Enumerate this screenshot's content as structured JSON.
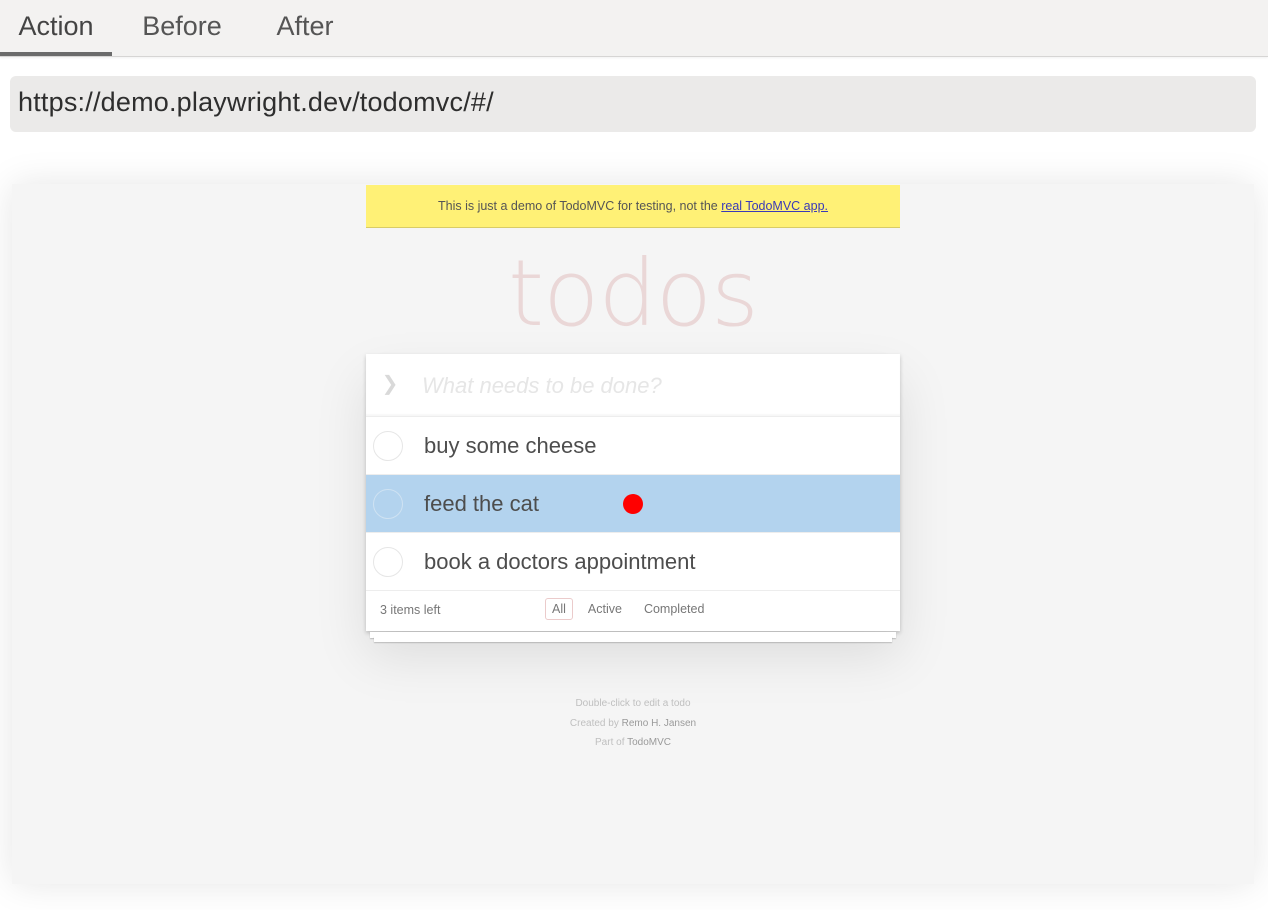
{
  "tabs": [
    {
      "label": "Action",
      "active": true
    },
    {
      "label": "Before",
      "active": false
    },
    {
      "label": "After",
      "active": false
    }
  ],
  "url": "https://demo.playwright.dev/todomvc/#/",
  "banner": {
    "text": "This is just a demo of TodoMVC for testing, not the ",
    "link": "real TodoMVC app."
  },
  "app": {
    "title": "todos",
    "toggle_all_icon": "chevron-down-icon",
    "input_placeholder": "What needs to be done?",
    "items": [
      {
        "label": "buy some cheese",
        "completed": false,
        "highlighted": false
      },
      {
        "label": "feed the cat",
        "completed": false,
        "highlighted": true
      },
      {
        "label": "book a doctors appointment",
        "completed": false,
        "highlighted": false
      }
    ],
    "footer": {
      "count": "3 items left",
      "filters": [
        {
          "label": "All",
          "selected": true
        },
        {
          "label": "Active",
          "selected": false
        },
        {
          "label": "Completed",
          "selected": false
        }
      ]
    }
  },
  "info": {
    "edit_hint": "Double-click to edit a todo",
    "created_prefix": "Created by ",
    "author": "Remo H. Jansen",
    "part_prefix": "Part of ",
    "part_link": "TodoMVC"
  },
  "colors": {
    "highlight": "#b3d3ee",
    "click_marker": "#ff0000",
    "banner": "#fff176"
  }
}
